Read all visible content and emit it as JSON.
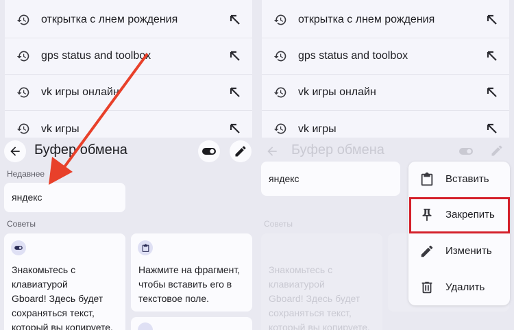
{
  "suggestions": [
    {
      "text": "открытка с лнем рождения",
      "icon": "history-icon",
      "action_icon": "fill-arrow-icon"
    },
    {
      "text": "gps status and toolbox",
      "icon": "history-icon",
      "action_icon": "fill-arrow-icon"
    },
    {
      "text": "vk игры онлайн",
      "icon": "history-icon",
      "action_icon": "fill-arrow-icon"
    },
    {
      "text": "vk игры",
      "icon": "history-icon",
      "action_icon": "fill-arrow-icon"
    }
  ],
  "clipboard": {
    "title": "Буфер обмена",
    "recent_label": "Недавнее",
    "recent_item": "яндекс",
    "tips_label": "Советы",
    "tips": [
      {
        "icon": "toggle-icon",
        "lines": [
          "Знакомьтесь с",
          "клавиатурой",
          "Gboard! Здесь будет",
          "сохраняться текст,",
          "который вы копируете."
        ]
      },
      {
        "icon": "clipboard-icon",
        "lines": [
          "Нажмите на фрагмент,",
          "чтобы вставить его в",
          "текстовое поле."
        ]
      }
    ]
  },
  "context_menu": {
    "items": [
      {
        "label": "Вставить",
        "icon": "paste-icon"
      },
      {
        "label": "Закрепить",
        "icon": "pin-icon",
        "highlighted": true
      },
      {
        "label": "Изменить",
        "icon": "pencil-icon"
      },
      {
        "label": "Удалить",
        "icon": "trash-icon"
      }
    ]
  },
  "colors": {
    "annotation_red": "#e8402a",
    "highlight_border": "#d4202a",
    "panel_bg": "#e9e9f1"
  }
}
